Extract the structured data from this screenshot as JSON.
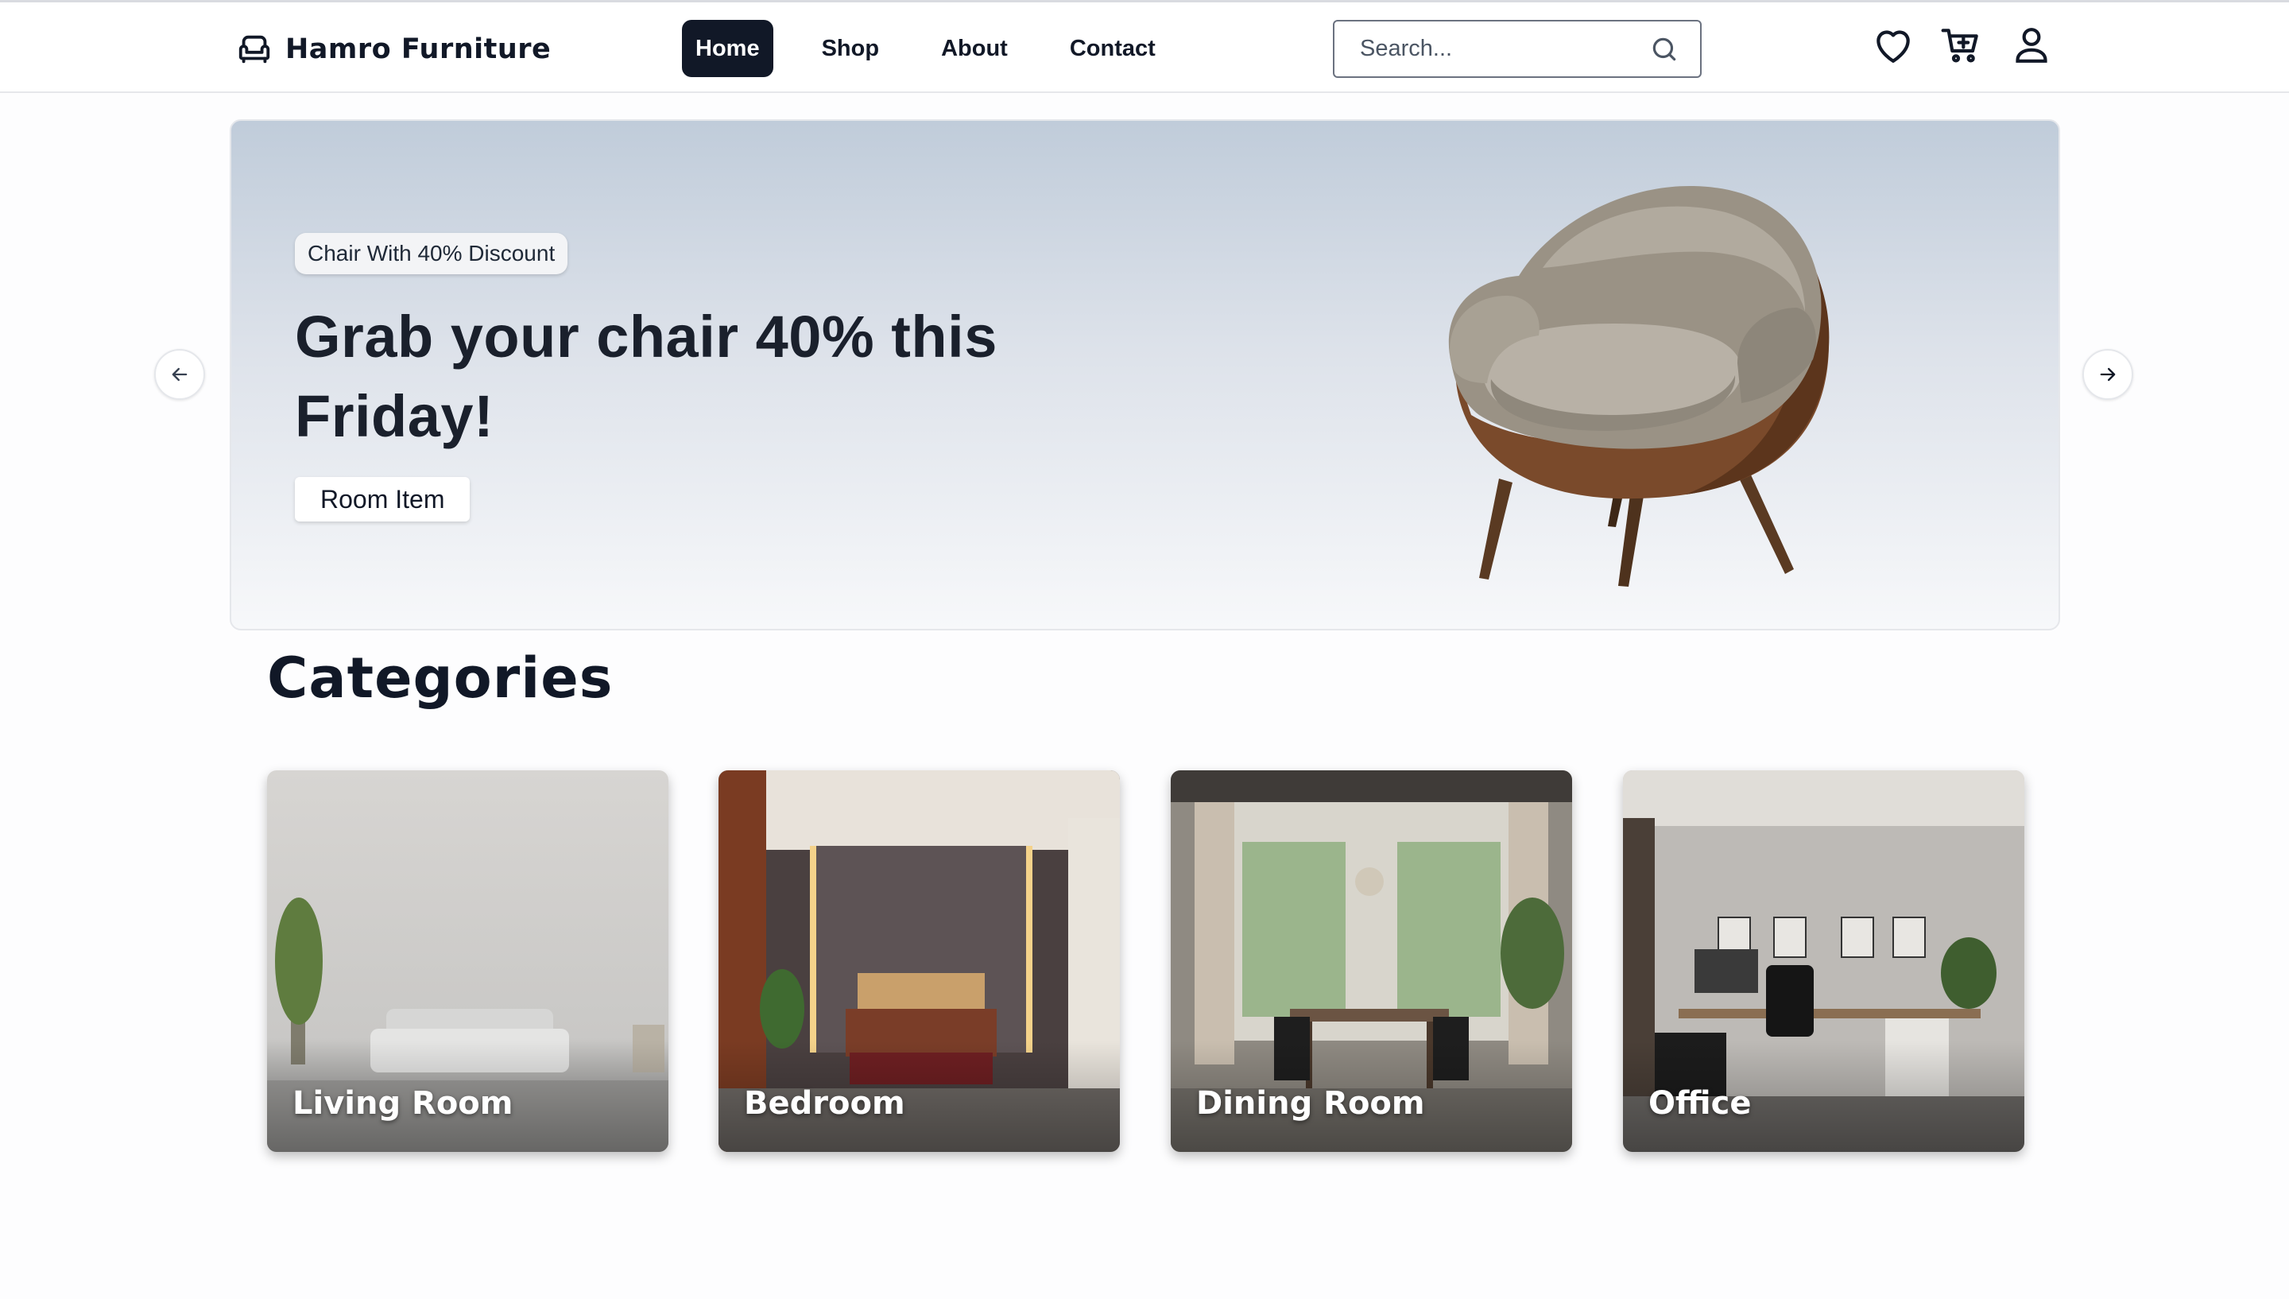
{
  "brand": {
    "name": "Hamro Furniture",
    "icon": "sofa-icon"
  },
  "nav": {
    "items": [
      {
        "label": "Home",
        "active": true
      },
      {
        "label": "Shop",
        "active": false
      },
      {
        "label": "About",
        "active": false
      },
      {
        "label": "Contact",
        "active": false
      }
    ]
  },
  "search": {
    "placeholder": "Search...",
    "value": "",
    "icon": "search-icon"
  },
  "header_icons": [
    "heart-icon",
    "cart-plus-icon",
    "user-icon"
  ],
  "hero": {
    "badge": "Chair With 40% Discount",
    "title": "Grab your chair 40% this Friday!",
    "button": "Room Item",
    "image": "armchair-image",
    "prev_icon": "arrow-left-icon",
    "next_icon": "arrow-right-icon"
  },
  "categories": {
    "title": "Categories",
    "items": [
      {
        "label": "Living Room"
      },
      {
        "label": "Bedroom"
      },
      {
        "label": "Dining Room"
      },
      {
        "label": "Office"
      }
    ]
  },
  "colors": {
    "primary": "#111827",
    "hero_top": "#c0ccda",
    "hero_bottom": "#f7f8fa"
  }
}
